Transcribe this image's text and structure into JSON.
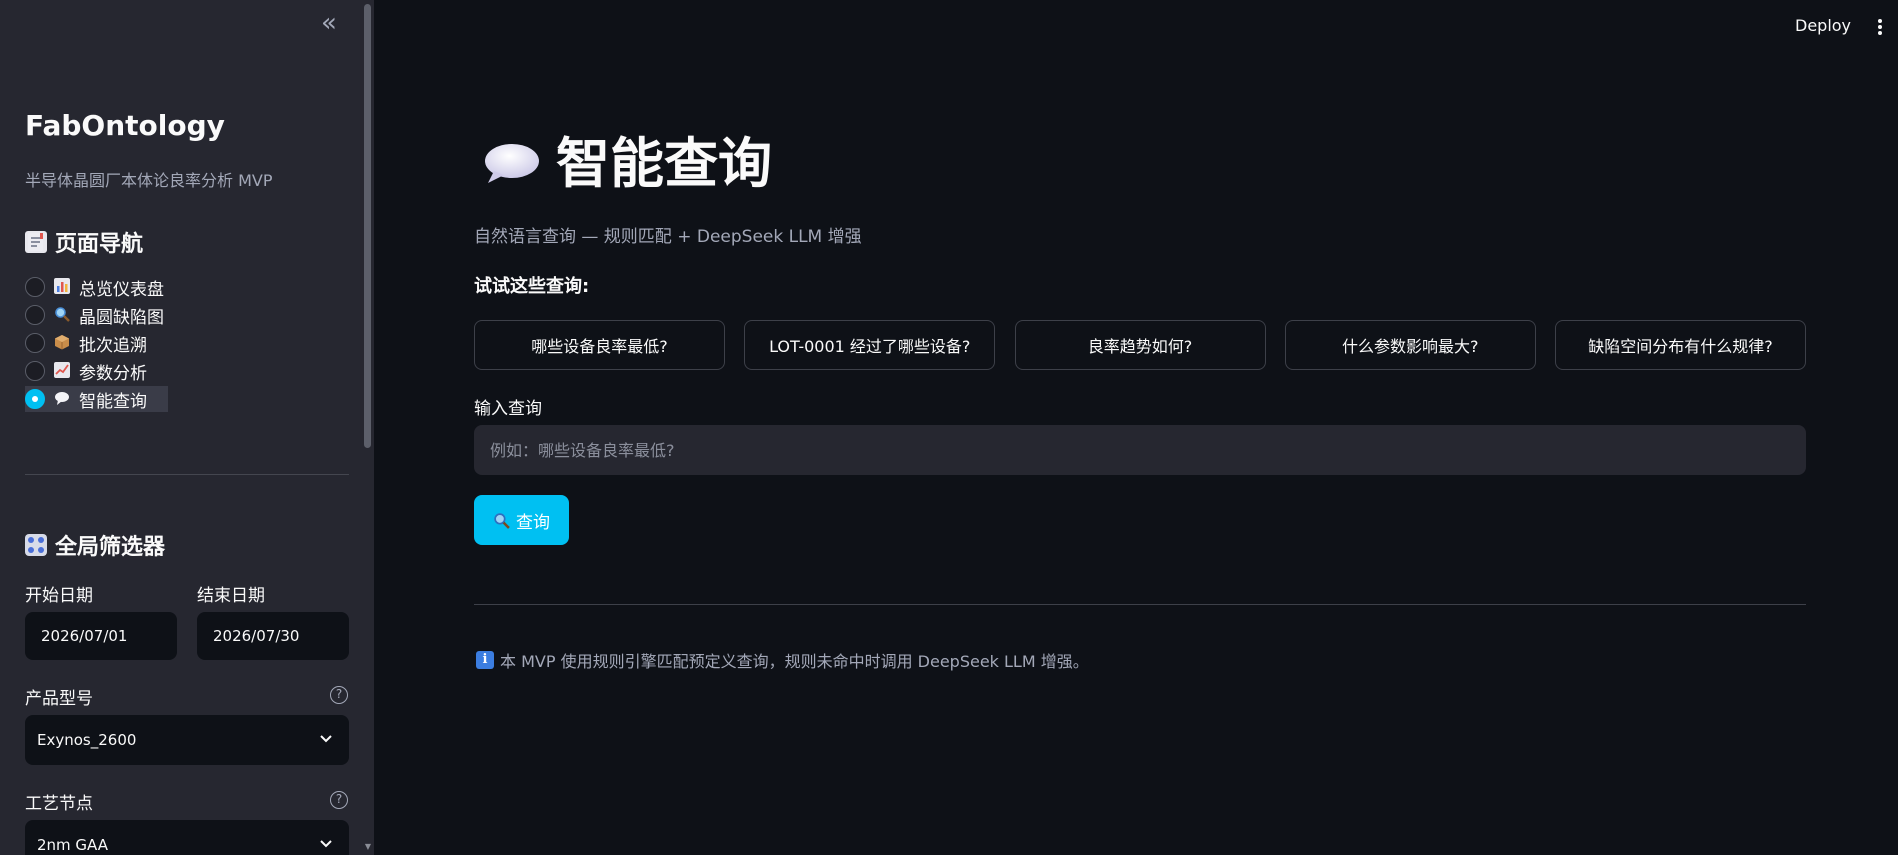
{
  "sidebar": {
    "collapse_glyph": "«",
    "app_title": "FabOntology",
    "app_subtitle": "半导体晶圆厂本体论良率分析 MVP",
    "nav_heading": "页面导航",
    "nav_items": [
      {
        "label": "总览仪表盘",
        "icon": "bar-chart-icon",
        "selected": false
      },
      {
        "label": "晶圆缺陷图",
        "icon": "magnifier-icon",
        "selected": false
      },
      {
        "label": "批次追溯",
        "icon": "package-icon",
        "selected": false
      },
      {
        "label": "参数分析",
        "icon": "trend-chart-icon",
        "selected": false
      },
      {
        "label": "智能查询",
        "icon": "speech-bubble-icon",
        "selected": true
      }
    ],
    "filter_heading": "全局筛选器",
    "start_date_label": "开始日期",
    "start_date_value": "2026/07/01",
    "end_date_label": "结束日期",
    "end_date_value": "2026/07/30",
    "product_label": "产品型号",
    "product_value": "Exynos_2600",
    "process_label": "工艺节点",
    "process_value": "2nm GAA"
  },
  "header": {
    "deploy_label": "Deploy"
  },
  "main": {
    "title": "智能查询",
    "caption": "自然语言查询 — 规则匹配 + DeepSeek LLM 增强",
    "try_heading": "试试这些查询:",
    "suggestions": [
      "哪些设备良率最低?",
      "LOT-0001 经过了哪些设备?",
      "良率趋势如何?",
      "什么参数影响最大?",
      "缺陷空间分布有什么规律?"
    ],
    "input_label": "输入查询",
    "input_placeholder": "例如：哪些设备良率最低?",
    "input_value": "",
    "query_button_label": "查询",
    "info_note": "本 MVP 使用规则引擎匹配预定义查询，规则未命中时调用 DeepSeek LLM 增强。"
  },
  "colors": {
    "background": "#0e1117",
    "sidebar": "#262730",
    "accent": "#00c0f2",
    "text": "#fafafa",
    "muted_text": "#a3a8b8"
  }
}
